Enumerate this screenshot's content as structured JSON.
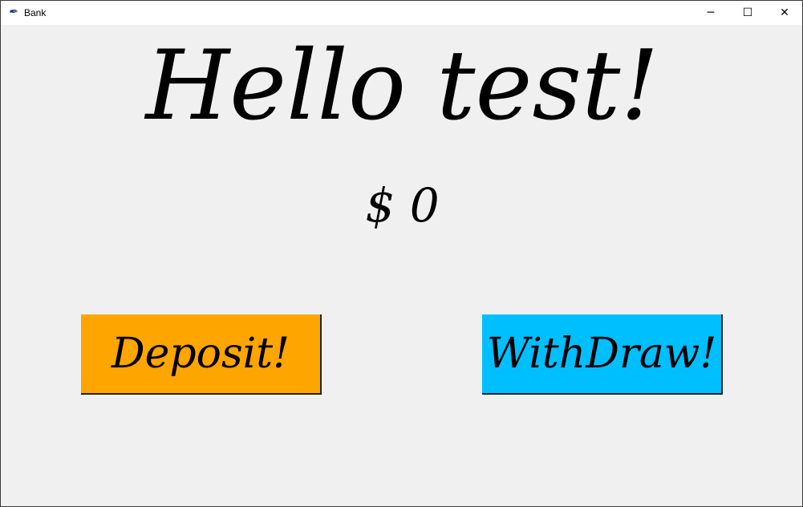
{
  "window": {
    "title": "Bank",
    "icon": "feather-icon"
  },
  "controls": {
    "minimize": "─",
    "maximize": "☐",
    "close": "✕"
  },
  "main": {
    "greeting": "Hello test!",
    "balance": "$ 0",
    "deposit_label": "Deposit!",
    "withdraw_label": "WithDraw!"
  },
  "colors": {
    "deposit": "#FFA500",
    "withdraw": "#00BFFF",
    "background": "#F0F0F0"
  }
}
